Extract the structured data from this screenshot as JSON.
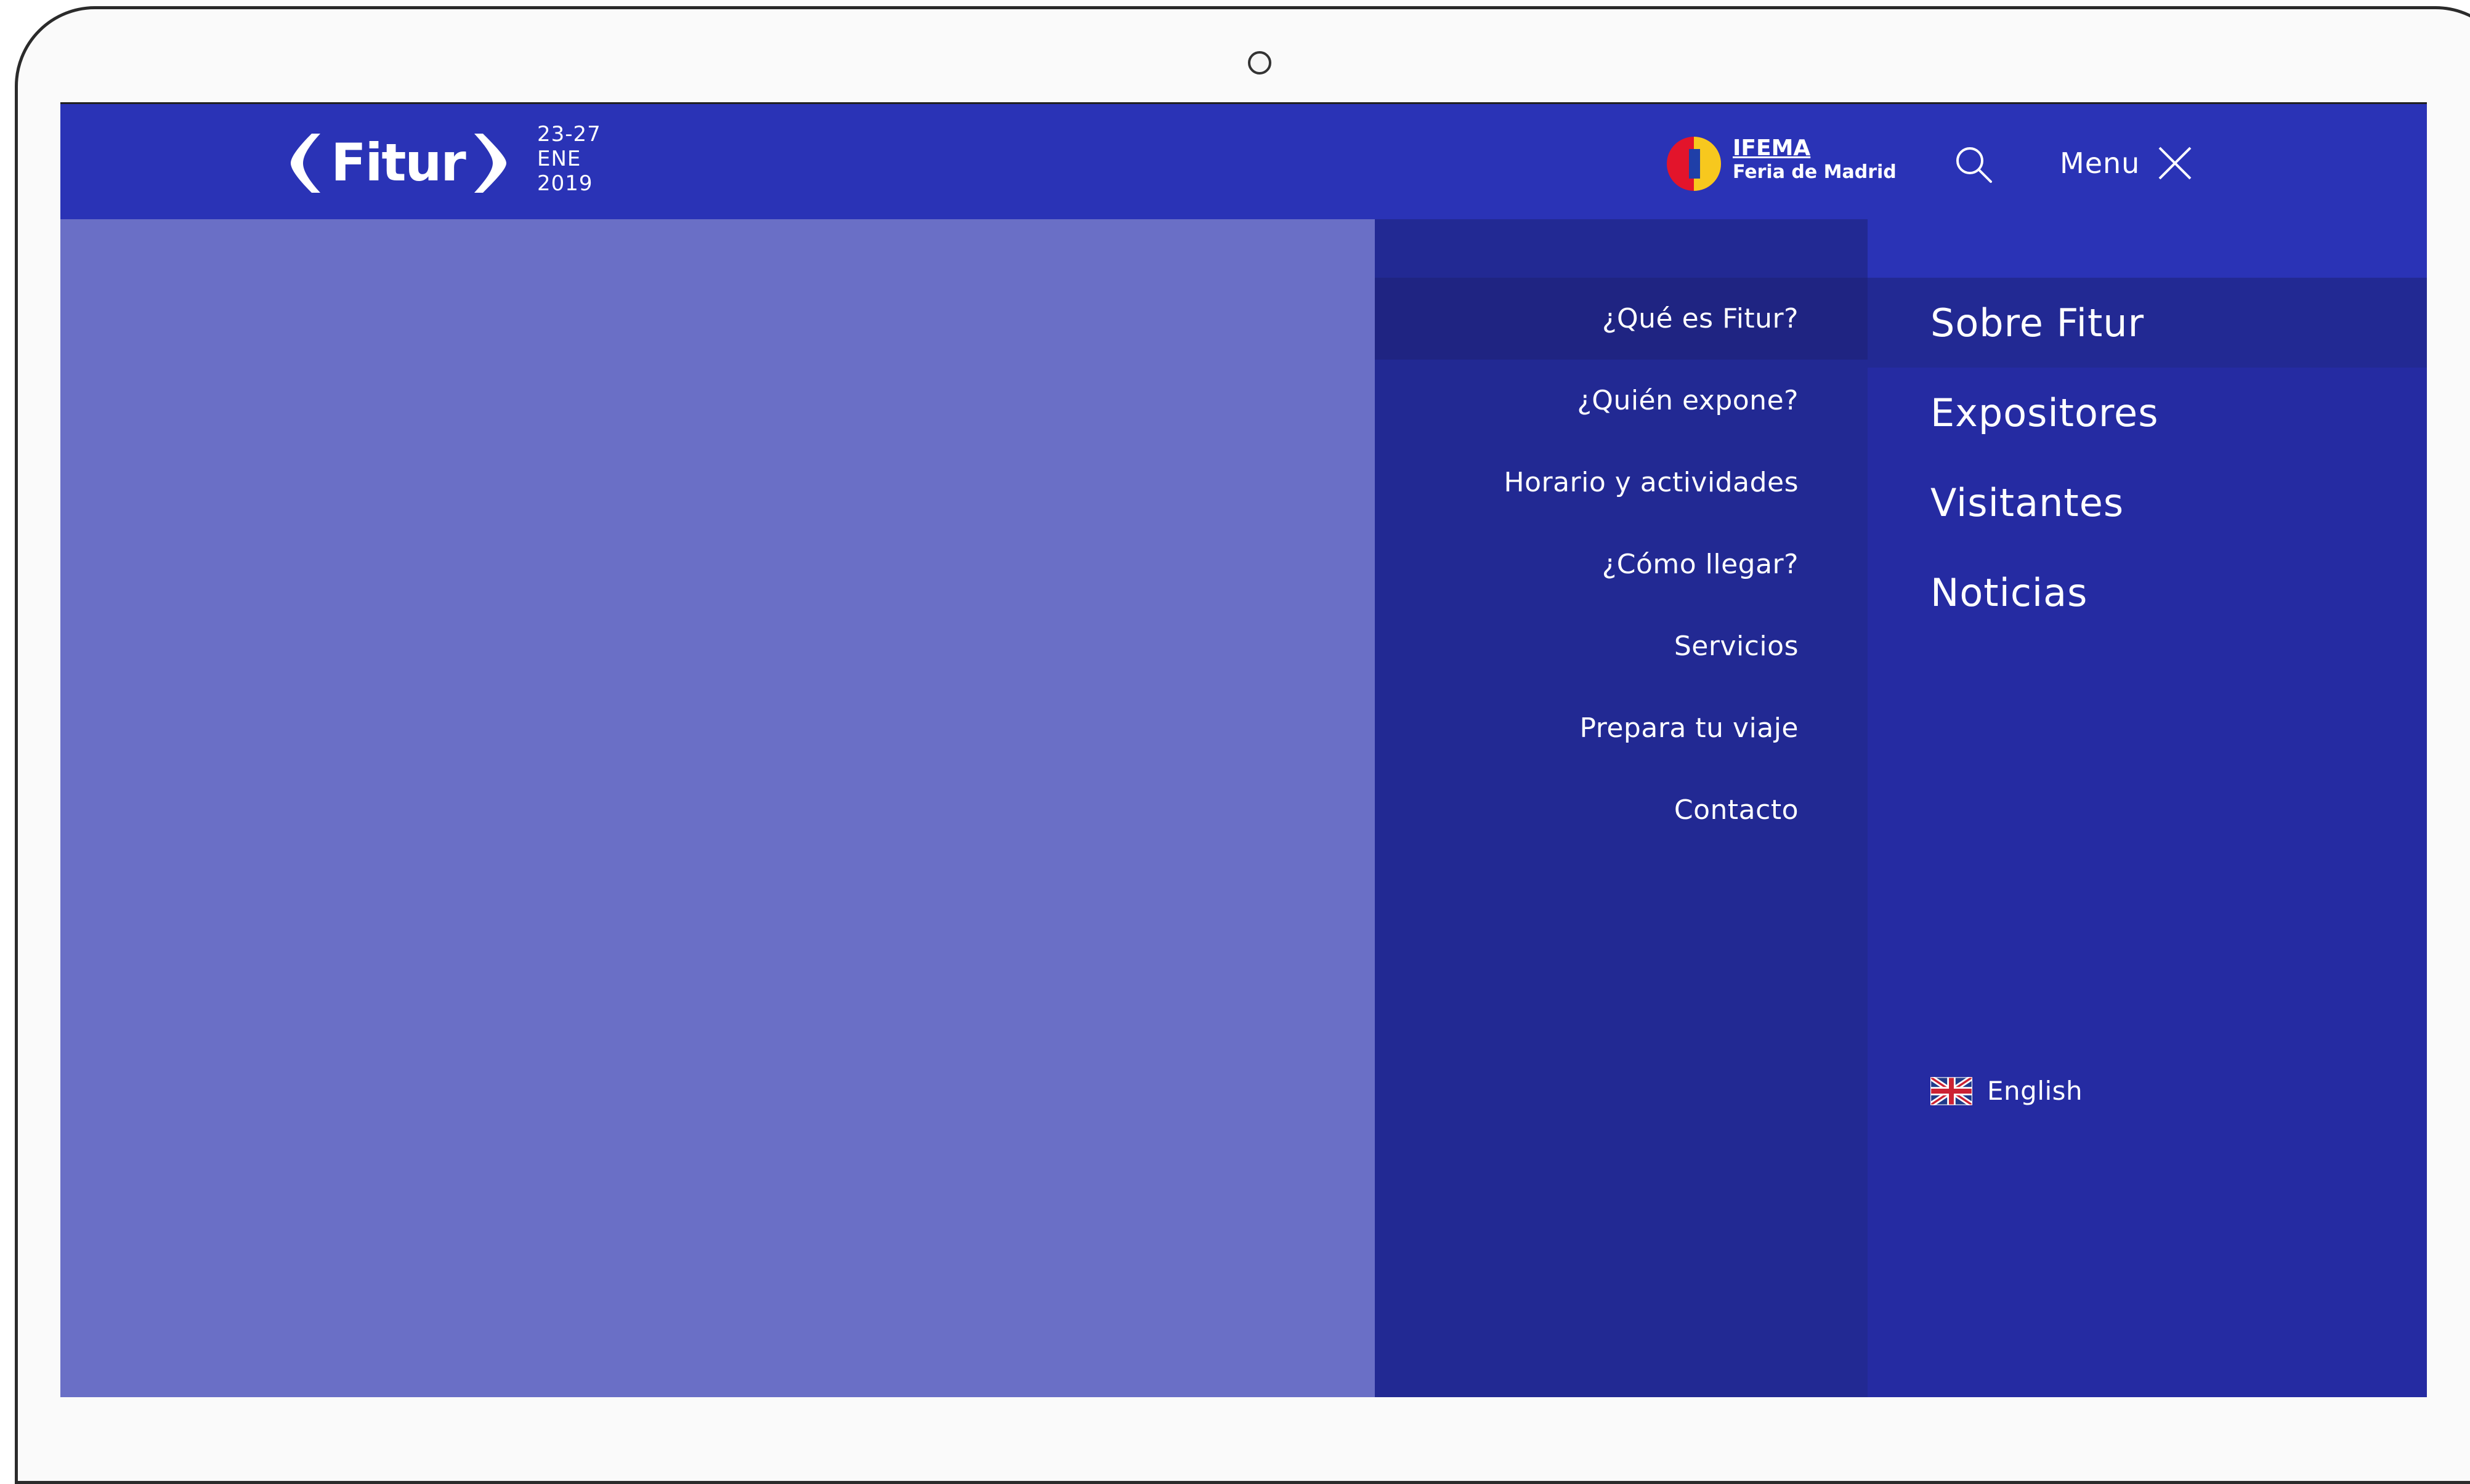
{
  "header": {
    "logo_text": "Fitur",
    "dates": {
      "days": "23-27",
      "month": "ENE",
      "year": "2019"
    },
    "partner": {
      "name": "IFEMA",
      "subtitle": "Feria de Madrid"
    },
    "search_icon": "search-icon",
    "menu_label": "Menu",
    "close_icon": "close-icon"
  },
  "submenu": {
    "items": [
      {
        "label": "¿Qué es Fitur?",
        "active": true
      },
      {
        "label": "¿Quién expone?",
        "active": false
      },
      {
        "label": "Horario y actividades",
        "active": false
      },
      {
        "label": "¿Cómo llegar?",
        "active": false
      },
      {
        "label": "Servicios",
        "active": false
      },
      {
        "label": "Prepara tu viaje",
        "active": false
      },
      {
        "label": "Contacto",
        "active": false
      }
    ]
  },
  "mainmenu": {
    "items": [
      {
        "label": "Sobre Fitur",
        "active": true
      },
      {
        "label": "Expositores",
        "active": false
      },
      {
        "label": "Visitantes",
        "active": false
      },
      {
        "label": "Noticias",
        "active": false
      }
    ]
  },
  "language": {
    "label": "English",
    "flag_icon": "uk-flag-icon"
  },
  "colors": {
    "header_bg": "#2a33b6",
    "content_bg": "#6a6fc6",
    "submenu_bg": "#222993",
    "submenu_active_bg": "#1f2482",
    "mainmenu_bg": "#252ba2",
    "ifema_red": "#e3142b",
    "ifema_yellow": "#f7c81e",
    "ifema_blue": "#1f3fa8"
  }
}
